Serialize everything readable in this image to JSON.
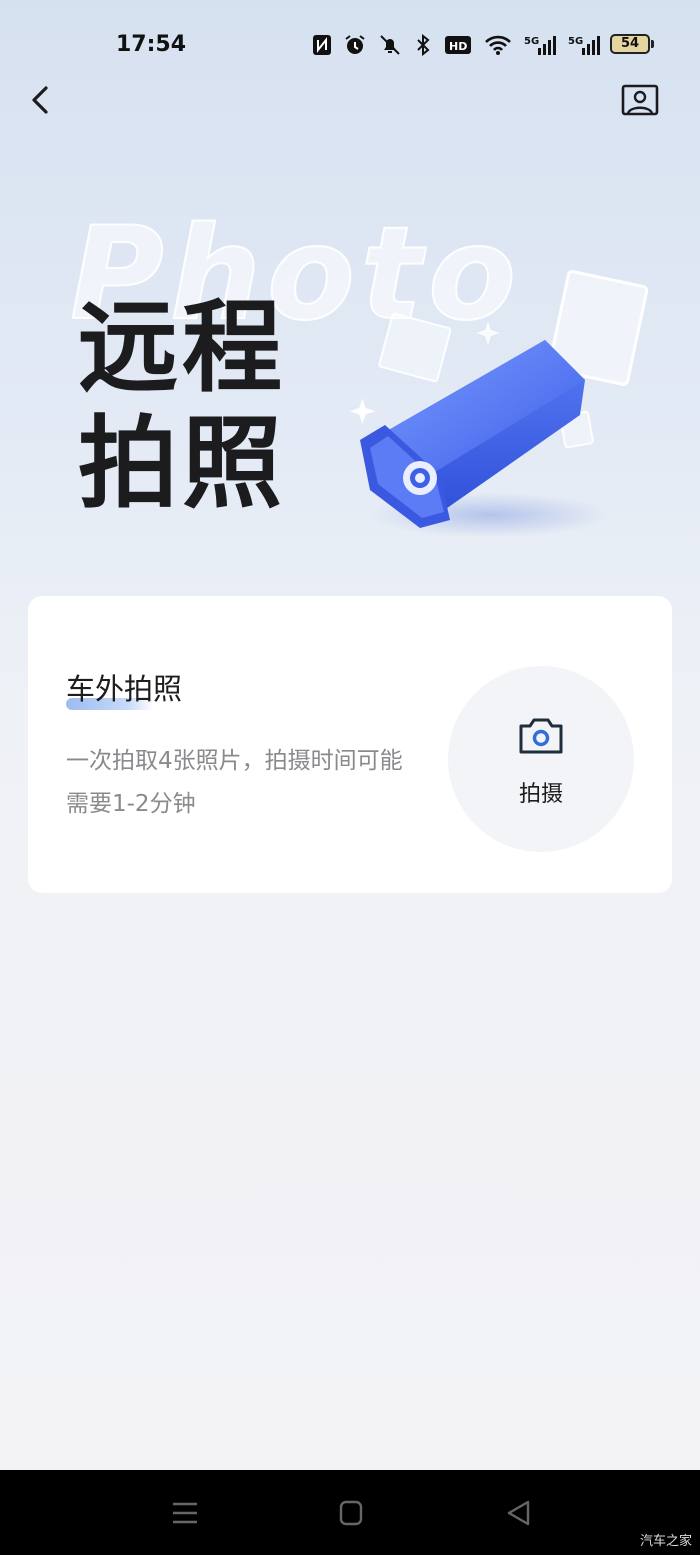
{
  "status_bar": {
    "time": "17:54",
    "battery": "54",
    "icons": [
      "nfc-icon",
      "alarm-icon",
      "mute-icon",
      "bluetooth-icon",
      "hd-icon",
      "wifi-icon",
      "signal-5g-icon",
      "signal-5g-icon"
    ],
    "hd_label": "HD",
    "net_label_1": "5G",
    "net_label_2": "5G"
  },
  "header": {
    "back_icon": "chevron-left-icon",
    "gallery_icon": "gallery-icon"
  },
  "hero": {
    "bg_word": "Photo",
    "title_line1": "远程",
    "title_line2": "拍照",
    "illustration": "security-camera-illustration"
  },
  "card": {
    "title": "车外拍照",
    "description": "一次拍取4张照片，拍摄时间可能需要1-2分钟",
    "button_label": "拍摄",
    "button_icon": "camera-icon"
  },
  "nav_bar": {
    "icons": [
      "menu-icon",
      "home-icon",
      "back-triangle-icon"
    ]
  },
  "watermark": "汽车之家",
  "colors": {
    "accent_blue": "#4a73f0",
    "title_text": "#1c1c1e",
    "muted_text": "#8a8a8e"
  }
}
